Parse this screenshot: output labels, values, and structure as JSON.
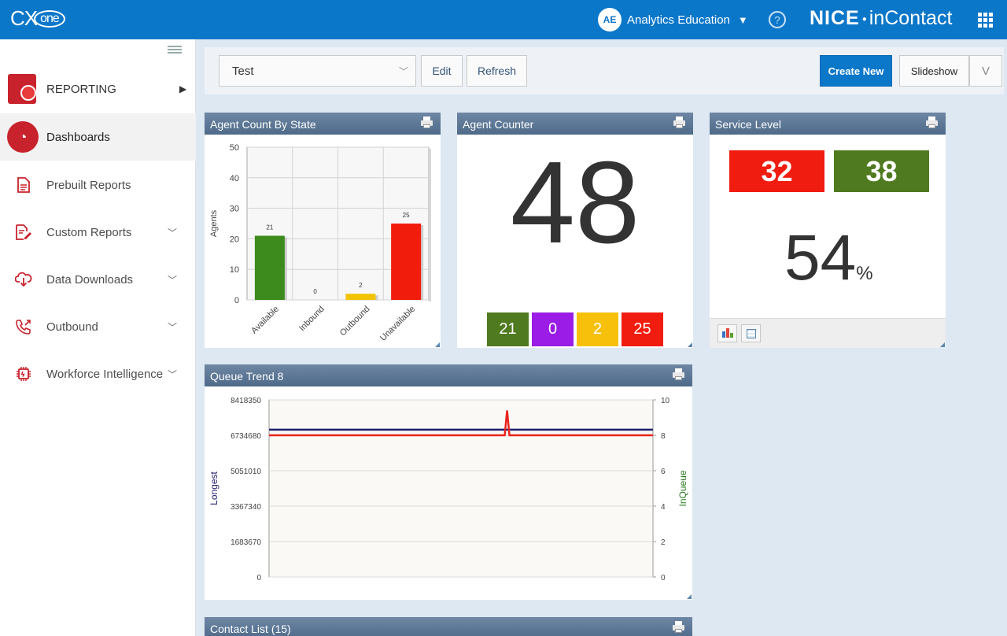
{
  "app": {
    "logo_text": "CX",
    "logo_suffix": "one",
    "brand_bold": "NICE",
    "brand_light": "inContact"
  },
  "user": {
    "initials": "AE",
    "name": "Analytics Education"
  },
  "sidebar": {
    "section": "REPORTING",
    "items": [
      {
        "label": "Dashboards",
        "icon": "gauge-icon",
        "active": true
      },
      {
        "label": "Prebuilt Reports",
        "icon": "document-icon"
      },
      {
        "label": "Custom Reports",
        "icon": "edit-document-icon"
      },
      {
        "label": "Data Downloads",
        "icon": "cloud-download-icon"
      },
      {
        "label": "Outbound",
        "icon": "phone-outbound-icon"
      },
      {
        "label": "Workforce Intelligence",
        "icon": "chip-icon"
      }
    ]
  },
  "toolbar": {
    "dashboard_select": "Test",
    "edit_label": "Edit",
    "refresh_label": "Refresh",
    "create_label": "Create New",
    "slideshow_label": "Slideshow",
    "slideshow_toggle": "V"
  },
  "widgets": {
    "agent_count_title": "Agent Count By State",
    "agent_counter_title": "Agent Counter",
    "service_level_title": "Service Level",
    "queue_trend_title": "Queue Trend 8",
    "contact_list_title": "Contact List (15)",
    "agent_counter": {
      "total": "48",
      "states": [
        {
          "value": "21",
          "color": "#4f7a1f"
        },
        {
          "value": "0",
          "color": "#9a1ce6"
        },
        {
          "value": "2",
          "color": "#f7c00a"
        },
        {
          "value": "25",
          "color": "#f01c10"
        }
      ]
    },
    "service_level": {
      "out_sla": "32",
      "in_sla": "38",
      "percent": "54",
      "percent_sign": "%",
      "out_color": "#f01c10",
      "in_color": "#4f7a1f"
    }
  },
  "chart_data": [
    {
      "type": "bar",
      "title": "Agent Count By State",
      "ylabel": "Agents",
      "categories": [
        "Available",
        "Inbound",
        "Outbound",
        "Unavailable"
      ],
      "values": [
        21,
        0,
        2,
        25
      ],
      "colors": [
        "#3d8b1c",
        "#7a2fd0",
        "#f2c300",
        "#f21c0c"
      ],
      "ylim": [
        0,
        50
      ],
      "yticks": [
        0,
        10,
        20,
        30,
        40,
        50
      ],
      "grid": true
    },
    {
      "type": "line",
      "title": "Queue Trend 8",
      "ylabel": "Longest",
      "y2label": "InQueue",
      "yticks": [
        0,
        1683670,
        3367340,
        5051010,
        6734680,
        8418350
      ],
      "y2ticks": [
        0,
        2,
        4,
        6,
        8,
        10
      ],
      "ylim": [
        0,
        8418350
      ],
      "y2lim": [
        0,
        10
      ],
      "series": [
        {
          "name": "Longest",
          "axis": "left",
          "color": "#1f1f6e",
          "baseline": 7000000,
          "spike_at": null,
          "spike_to": null
        },
        {
          "name": "InQueue",
          "axis": "right",
          "color": "#e8241c",
          "baseline": 8.0,
          "spike_at": 0.62,
          "spike_to": 9.4
        }
      ],
      "grid": true
    }
  ]
}
